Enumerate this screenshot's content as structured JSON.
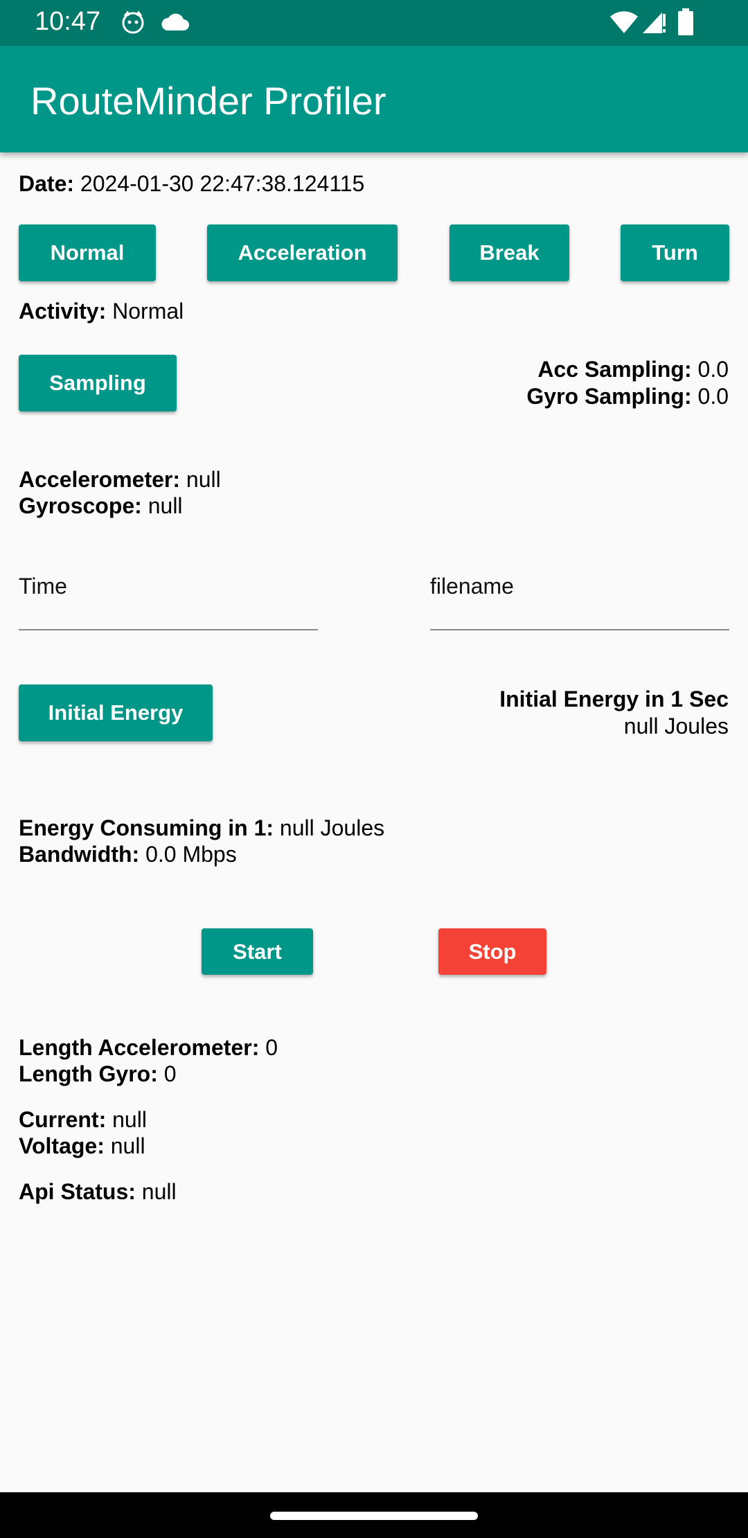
{
  "status_bar": {
    "time": "10:47",
    "icons": [
      "cat-notification-icon",
      "cloud-icon",
      "wifi-icon",
      "signal-icon",
      "battery-icon"
    ]
  },
  "app_bar": {
    "title": "RouteMinder Profiler"
  },
  "date": {
    "label": "Date:",
    "value": " 2024-01-30 22:47:38.124115"
  },
  "activity_buttons": {
    "normal": "Normal",
    "acceleration": "Acceleration",
    "break": "Break",
    "turn": "Turn"
  },
  "activity": {
    "label": "Activity:",
    "value": " Normal"
  },
  "sampling_button": "Sampling",
  "acc_sampling": {
    "label": "Acc Sampling:",
    "value": " 0.0"
  },
  "gyro_sampling": {
    "label": "Gyro Sampling:",
    "value": " 0.0"
  },
  "accelerometer": {
    "label": "Accelerometer:",
    "value": " null"
  },
  "gyroscope": {
    "label": "Gyroscope:",
    "value": " null"
  },
  "inputs": {
    "time_placeholder": "Time",
    "filename_placeholder": "filename"
  },
  "initial_energy_button": "Initial Energy",
  "initial_energy": {
    "label": "Initial Energy in 1 Sec",
    "value": "null Joules"
  },
  "energy_consuming": {
    "label": "Energy Consuming in 1:",
    "value": " null Joules"
  },
  "bandwidth": {
    "label": "Bandwidth:",
    "value": " 0.0 Mbps"
  },
  "start_button": "Start",
  "stop_button": "Stop",
  "length_accelerometer": {
    "label": "Length Accelerometer:",
    "value": " 0"
  },
  "length_gyro": {
    "label": "Length Gyro:",
    "value": " 0"
  },
  "current": {
    "label": "Current:",
    "value": " null"
  },
  "voltage": {
    "label": "Voltage:",
    "value": " null"
  },
  "api_status": {
    "label": "Api Status:",
    "value": " null"
  },
  "colors": {
    "primary": "#009688",
    "primary_dark": "#00796b",
    "stop": "#f44336",
    "background": "#fafafa"
  }
}
